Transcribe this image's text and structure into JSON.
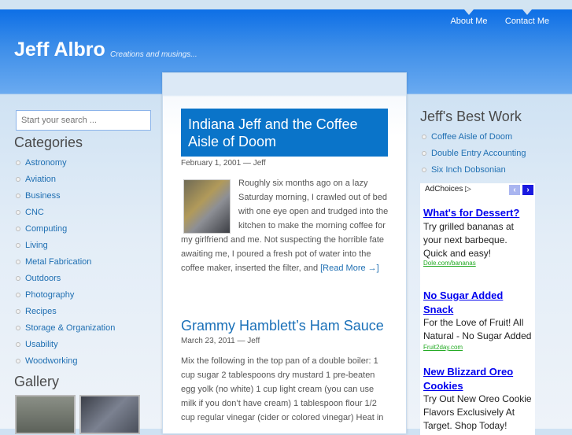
{
  "site": {
    "title": "Jeff Albro",
    "tagline": "Creations and musings..."
  },
  "nav": [
    {
      "label": "About Me"
    },
    {
      "label": "Contact Me"
    }
  ],
  "search": {
    "placeholder": "Start your search ..."
  },
  "categories": {
    "heading": "Categories",
    "items": [
      "Astronomy",
      "Aviation",
      "Business",
      "CNC",
      "Computing",
      "Living",
      "Metal Fabrication",
      "Outdoors",
      "Photography",
      "Recipes",
      "Storage & Organization",
      "Usability",
      "Woodworking"
    ]
  },
  "gallery": {
    "heading": "Gallery"
  },
  "posts": [
    {
      "title": "Indiana Jeff and the Coffee Aisle of Doom",
      "meta": "February 1, 2001 — Jeff",
      "excerpt": "Roughly six months ago on a lazy Saturday morning, I crawled out of bed with one eye open and trudged into the kitchen to make the morning coffee for my girlfriend and me. Not suspecting the horrible fate awaiting me, I poured a fresh pot of water into the coffee maker, inserted the filter, and ",
      "read_more": "[Read More →]"
    },
    {
      "title": "Grammy Hamblett’s Ham Sauce",
      "meta": "March 23, 2011 — Jeff",
      "excerpt": "Mix the following in the top pan of a double boiler: 1 cup sugar 2 tablespoons dry mustard 1 pre-beaten egg yolk (no white) 1 cup light cream (you can use milk if you don’t have cream) 1 tablespoon flour 1/2 cup regular vinegar (cider or colored vinegar) Heat in"
    }
  ],
  "best_work": {
    "heading": "Jeff's Best Work",
    "items": [
      "Coffee Aisle of Doom",
      "Double Entry Accounting",
      "Six Inch Dobsonian"
    ]
  },
  "ads": {
    "adchoices": "AdChoices ▷",
    "prev": "‹",
    "next": "›",
    "items": [
      {
        "title": "What's for Dessert?",
        "desc": "Try grilled bananas at your next barbeque. Quick and easy!",
        "url": "Dole.com/bananas"
      },
      {
        "title": "No Sugar Added Snack",
        "desc": "For the Love of Fruit! All Natural - No Sugar Added",
        "url": "Fruit2day.com"
      },
      {
        "title": "New Blizzard Oreo Cookies",
        "desc": "Try Out New Oreo Cookie Flavors Exclusively At Target. Shop Today!"
      }
    ]
  }
}
